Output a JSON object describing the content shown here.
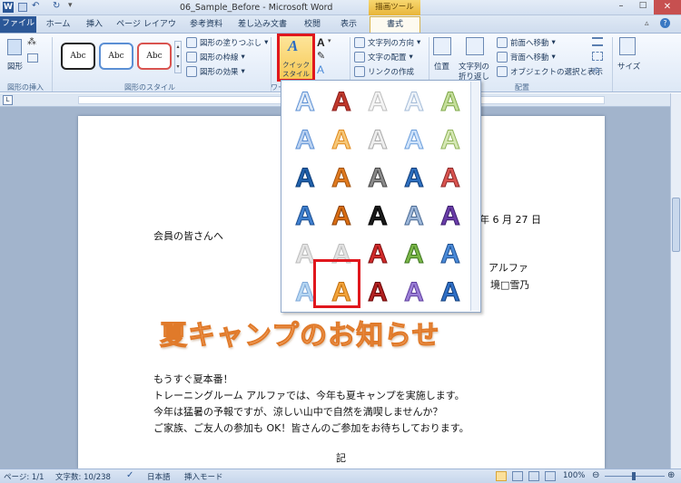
{
  "window": {
    "title": "06_Sample_Before - Microsoft Word",
    "drawing_tools": "描画ツール"
  },
  "tabs": [
    "ファイル",
    "ホーム",
    "挿入",
    "ページ レイアウト",
    "参考資料",
    "差し込み文書",
    "校閲",
    "表示",
    "書式"
  ],
  "ribbon": {
    "shape_label": "図形",
    "insert_group": "図形の挿入",
    "style_samples": [
      "Abc",
      "Abc",
      "Abc"
    ],
    "fill": "図形の塗りつぶし",
    "outline": "図形の枠線",
    "effects": "図形の効果",
    "style_group": "図形のスタイル",
    "quick_style": [
      "クイック",
      "スタイル"
    ],
    "wordart_group": "ワー",
    "text_direction": "文字列の方向",
    "text_align": "文字の配置",
    "create_link": "リンクの作成",
    "position": "位置",
    "wrap": [
      "文字列の",
      "折り返し"
    ],
    "bring_forward": "前面へ移動",
    "send_backward": "背面へ移動",
    "selection_pane": "オブジェクトの選択と表示",
    "arrange_group": "配置",
    "size": "サイズ"
  },
  "document": {
    "date": "年 6 月 27 日",
    "greeting": "会員の皆さんへ",
    "sender1": "アルファ",
    "sender2": "境□雪乃",
    "wordart": "夏キャンプのお知らせ",
    "lines": [
      "もうすぐ夏本番！",
      "トレーニングルーム アルファでは、今年も夏キャンプを実施します。",
      "今年は猛暑の予報ですが、涼しい山中で自然を満喫しませんか？",
      "ご家族、ご友人の参加も OK！皆さんのご参加をお待ちしております。"
    ],
    "ki": "記"
  },
  "gallery": {
    "glyph": "A"
  },
  "status": {
    "page": "ページ: 1/1",
    "words": "文字数: 10/238",
    "lang": "日本語",
    "mode": "挿入モード",
    "zoom": "100%"
  },
  "colors": {
    "highlight": "#e0171d",
    "wordart_fill": "#f5a86a",
    "wordart_outline": "#e07a2a"
  }
}
